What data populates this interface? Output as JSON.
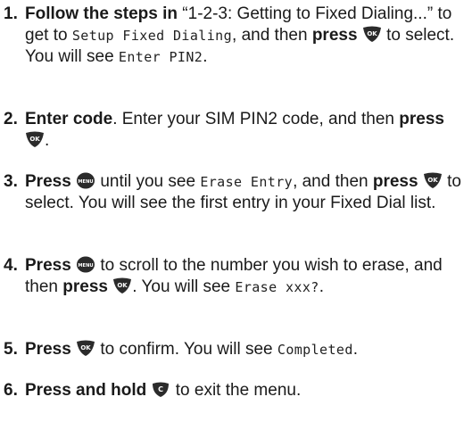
{
  "steps": [
    {
      "number": "1.",
      "parts": {
        "a": "Follow the steps in",
        "b": " “1-2-3: Getting to Fixed Dialing...” to get to ",
        "c": "Setup Fixed Dialing",
        "d": ", and then ",
        "e": "press",
        "f": " to select. You will see ",
        "g": "Enter PIN2",
        "h": "."
      }
    },
    {
      "number": "2.",
      "parts": {
        "a": "Enter code",
        "b": ". Enter your SIM PIN2 code, and then ",
        "c": "press",
        "d": "."
      }
    },
    {
      "number": "3.",
      "parts": {
        "a": "Press",
        "b": " until you see ",
        "c": "Erase Entry",
        "d": ", and then ",
        "e": "press",
        "f": " to select. You will see the first entry in your Fixed Dial list."
      }
    },
    {
      "number": "4.",
      "parts": {
        "a": "Press",
        "b": " to scroll to the number you wish to erase, and then ",
        "c": "press",
        "d": ". You will see ",
        "e": "Erase xxx?",
        "f": "."
      }
    },
    {
      "number": "5.",
      "parts": {
        "a": "Press",
        "b": " to confirm. You will see ",
        "c": "Completed",
        "d": "."
      }
    },
    {
      "number": "6.",
      "parts": {
        "a": "Press and hold",
        "b": " to exit the menu."
      }
    }
  ],
  "icons": {
    "ok": "OK",
    "menu": "MENU",
    "clear": "C"
  }
}
